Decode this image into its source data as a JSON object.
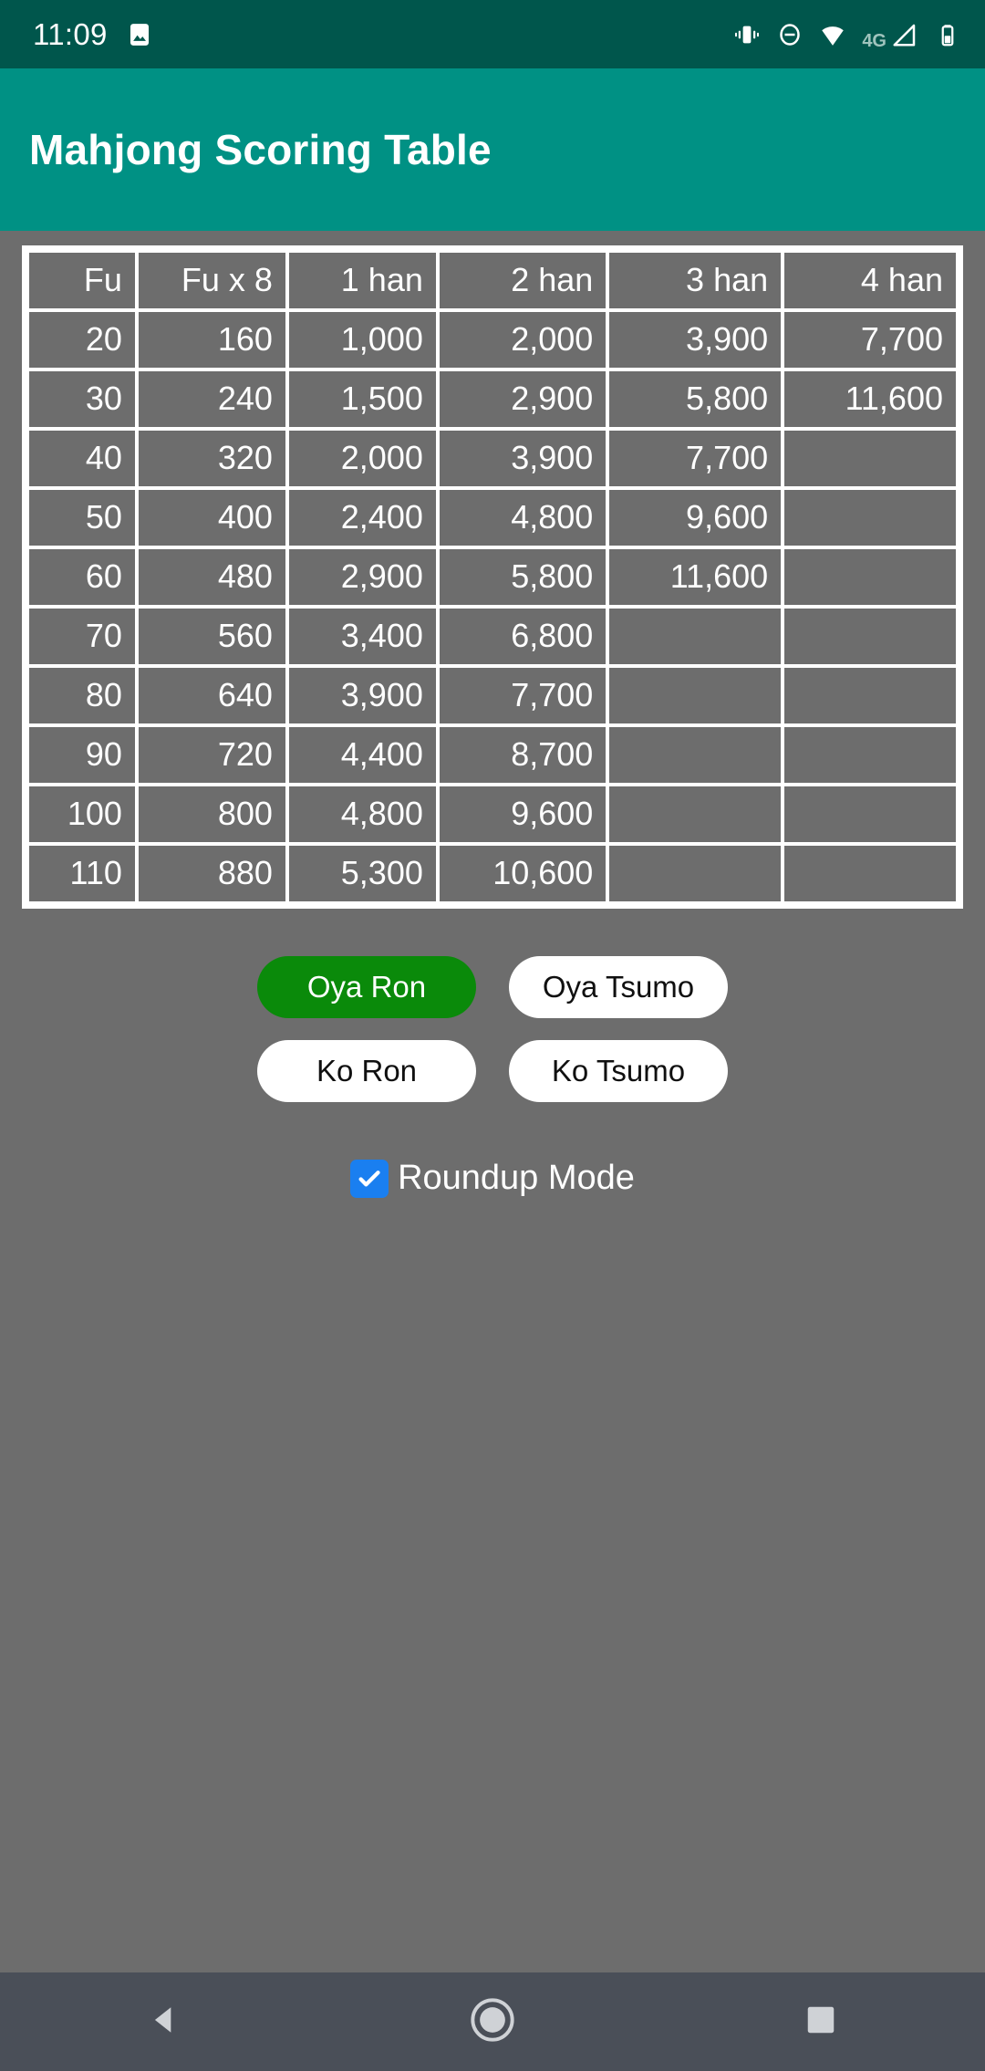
{
  "status_bar": {
    "time": "11:09",
    "network_label": "4G",
    "icons": [
      "gallery-icon",
      "vibrate-icon",
      "do-not-disturb-icon",
      "wifi-icon",
      "signal-icon",
      "battery-icon"
    ],
    "background_color": "#00564C"
  },
  "app_bar": {
    "title": "Mahjong Scoring Table",
    "background_color": "#009184"
  },
  "table": {
    "headers": [
      "Fu",
      "Fu x 8",
      "1 han",
      "2 han",
      "3 han",
      "4 han"
    ],
    "rows": [
      {
        "cells": [
          "20",
          "160",
          "1,000",
          "2,000",
          "3,900",
          "7,700"
        ],
        "dim": [
          false,
          false,
          true,
          true,
          true,
          true
        ]
      },
      {
        "cells": [
          "30",
          "240",
          "1,500",
          "2,900",
          "5,800",
          "11,600"
        ],
        "dim": [
          false,
          false,
          false,
          false,
          false,
          false
        ]
      },
      {
        "cells": [
          "40",
          "320",
          "2,000",
          "3,900",
          "7,700",
          ""
        ],
        "dim": [
          false,
          false,
          false,
          false,
          false,
          false
        ]
      },
      {
        "cells": [
          "50",
          "400",
          "2,400",
          "4,800",
          "9,600",
          ""
        ],
        "dim": [
          false,
          false,
          false,
          false,
          false,
          false
        ]
      },
      {
        "cells": [
          "60",
          "480",
          "2,900",
          "5,800",
          "11,600",
          ""
        ],
        "dim": [
          false,
          false,
          false,
          false,
          false,
          false
        ]
      },
      {
        "cells": [
          "70",
          "560",
          "3,400",
          "6,800",
          "",
          ""
        ],
        "dim": [
          false,
          false,
          false,
          false,
          false,
          false
        ]
      },
      {
        "cells": [
          "80",
          "640",
          "3,900",
          "7,700",
          "",
          ""
        ],
        "dim": [
          false,
          false,
          false,
          false,
          false,
          false
        ]
      },
      {
        "cells": [
          "90",
          "720",
          "4,400",
          "8,700",
          "",
          ""
        ],
        "dim": [
          false,
          false,
          false,
          false,
          false,
          false
        ]
      },
      {
        "cells": [
          "100",
          "800",
          "4,800",
          "9,600",
          "",
          ""
        ],
        "dim": [
          false,
          false,
          false,
          false,
          false,
          false
        ]
      },
      {
        "cells": [
          "110",
          "880",
          "5,300",
          "10,600",
          "",
          ""
        ],
        "dim": [
          false,
          false,
          false,
          false,
          false,
          false
        ]
      }
    ]
  },
  "buttons": {
    "oya_ron": "Oya Ron",
    "oya_tsumo": "Oya Tsumo",
    "ko_ron": "Ko Ron",
    "ko_tsumo": "Ko Tsumo",
    "selected": "Oya Ron",
    "active_color": "#0A8A0A",
    "idle_color": "#FFFFFF"
  },
  "roundup": {
    "label": "Roundup Mode",
    "checked": true,
    "checkbox_color": "#1A7FF0"
  },
  "nav_bar": {
    "back": "back-triangle-icon",
    "home": "home-circle-icon",
    "recents": "recents-square-icon",
    "background_color": "#4A4F58"
  }
}
